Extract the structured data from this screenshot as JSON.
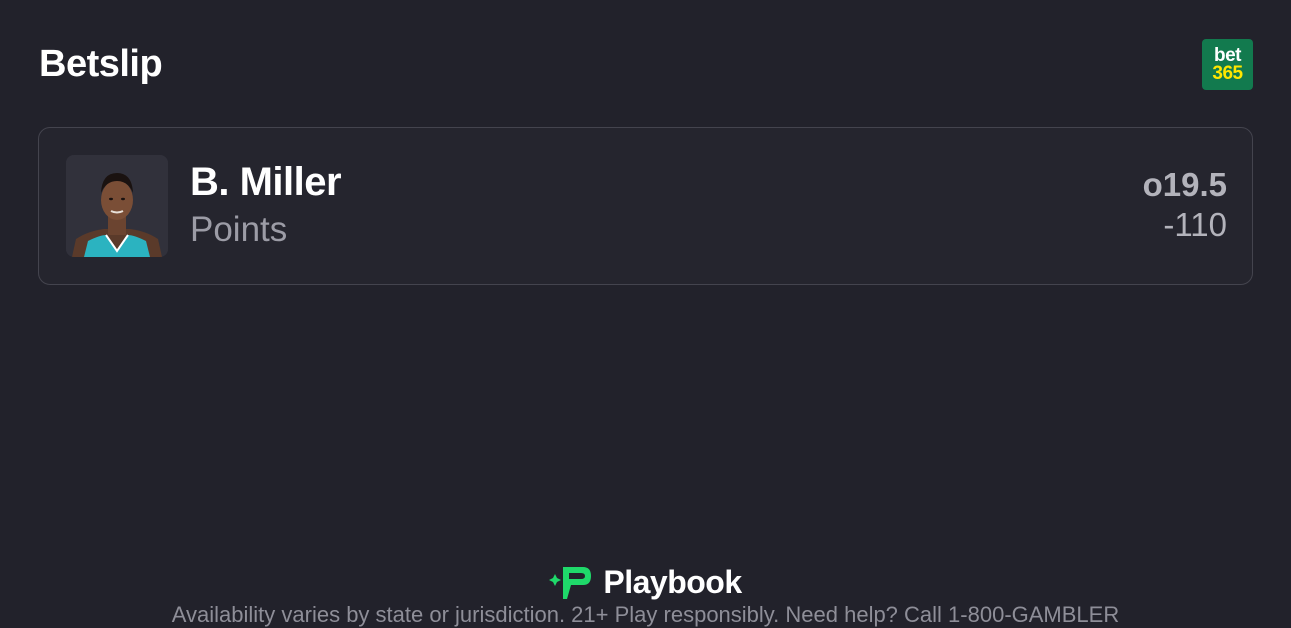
{
  "header": {
    "title": "Betslip",
    "sportsbook_logo": {
      "line1": "bet",
      "line2": "365",
      "bg_color": "#127a4e",
      "accent_color": "#ffe600"
    }
  },
  "selection": {
    "player_name": "B. Miller",
    "market": "Points",
    "line": "o19.5",
    "odds": "-110",
    "jersey_color": "#2bb3c0"
  },
  "footer": {
    "brand": "Playbook",
    "brand_color": "#1fd96a",
    "disclaimer": "Availability varies by state or jurisdiction. 21+ Play responsibly. Need help? Call 1-800-GAMBLER"
  }
}
